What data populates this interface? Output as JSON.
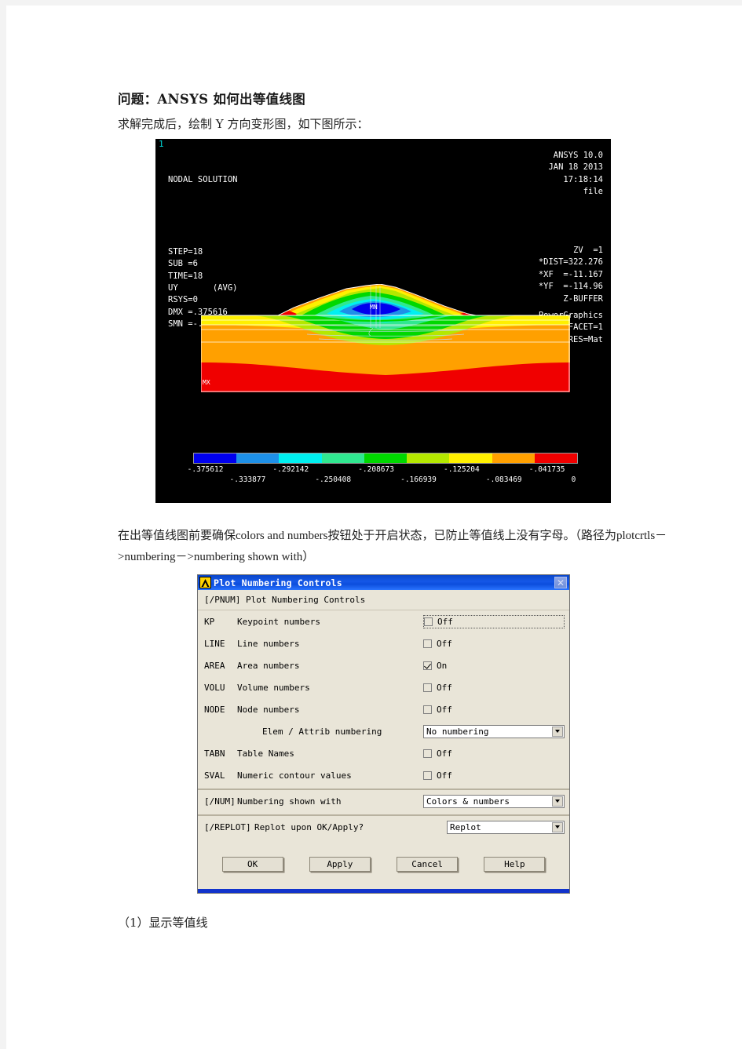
{
  "document": {
    "heading": "问题：ANSYS 如何出等值线图",
    "line_after_heading": "求解完成后，绘制 Y 方向变形图，如下图所示：",
    "paragraph_cn_1": "在出等值线图前要确保",
    "paragraph_en_1": "colors  and  numbers",
    "paragraph_cn_2": "按钮处于开启状态，已防止等值线上没有字母。（路径为",
    "paragraph_en_2": "plotcrtls－>numbering－>numbering  shown  with",
    "paragraph_cn_3": "）",
    "footer_line": "（1）显示等值线"
  },
  "ansys_plot": {
    "window_number": "1",
    "header_left": "NODAL SOLUTION",
    "left_block": "STEP=18\nSUB =6\nTIME=18\nUY       (AVG)\nRSYS=0\nDMX =.375616\nSMN =-.375612",
    "right_block": "ANSYS 10.0\nJAN 18 2013\n17:18:14\nfile",
    "right_block_2": "ZV  =1\n*DIST=322.276\n*XF  =-11.167\n*YF  =-114.96\nZ-BUFFER",
    "right_block_3": "PowerGraphics\nEFACET=1\nAVRES=Mat",
    "min_marker": "MN",
    "max_marker": "MX",
    "colorbar_colors": [
      "#0000ee",
      "#1e90e8",
      "#00f0f0",
      "#30e890",
      "#00d800",
      "#b4e800",
      "#fff000",
      "#ffa000",
      "#f00000"
    ],
    "legend_row1": [
      "-.375612",
      "-.292142",
      "-.208673",
      "-.125204",
      "-.041735"
    ],
    "legend_row2": [
      "-.333877",
      "-.250408",
      "-.166939",
      "-.083469",
      "0"
    ]
  },
  "chart_data": {
    "type": "heatmap",
    "title": "NODAL SOLUTION UY (AVG)",
    "xlabel": "",
    "ylabel": "",
    "colorbar_levels": [
      -0.375612,
      -0.333877,
      -0.292142,
      -0.250408,
      -0.208673,
      -0.166939,
      -0.125204,
      -0.083469,
      -0.041735,
      0
    ],
    "colorbar_colors": [
      "#0000ee",
      "#1e90e8",
      "#00f0f0",
      "#30e890",
      "#00d800",
      "#b4e800",
      "#fff000",
      "#ffa000",
      "#f00000"
    ],
    "legend_position": "bottom",
    "grid": false,
    "annotations": [
      "MN",
      "MX"
    ],
    "metadata_labels": {
      "STEP": "18",
      "SUB": "6",
      "TIME": "18",
      "RESULT": "UY (AVG)",
      "RSYS": "0",
      "DMX": ".375616",
      "SMN": "-.375612",
      "ZV": "1",
      "DIST": "322.276",
      "XF": "-11.167",
      "YF": "-114.96"
    }
  },
  "dialog": {
    "title": "Plot Numbering Controls",
    "close_glyph": "✕",
    "header": "[/PNUM]  Plot Numbering Controls",
    "rows": [
      {
        "code": "KP",
        "label": "Keypoint numbers",
        "control": "checkbox",
        "checked": false,
        "value": "Off",
        "focused": true
      },
      {
        "code": "LINE",
        "label": "Line numbers",
        "control": "checkbox",
        "checked": false,
        "value": "Off",
        "focused": false
      },
      {
        "code": "AREA",
        "label": "Area numbers",
        "control": "checkbox",
        "checked": true,
        "value": "On",
        "focused": false
      },
      {
        "code": "VOLU",
        "label": "Volume numbers",
        "control": "checkbox",
        "checked": false,
        "value": "Off",
        "focused": false
      },
      {
        "code": "NODE",
        "label": "Node numbers",
        "control": "checkbox",
        "checked": false,
        "value": "Off",
        "focused": false
      },
      {
        "code": "",
        "label": "Elem / Attrib numbering",
        "control": "combo",
        "value": "No numbering",
        "focused": false
      },
      {
        "code": "TABN",
        "label": "Table Names",
        "control": "checkbox",
        "checked": false,
        "value": "Off",
        "focused": false
      },
      {
        "code": "SVAL",
        "label": "Numeric contour values",
        "control": "checkbox",
        "checked": false,
        "value": "Off",
        "focused": false
      }
    ],
    "num_row": {
      "code": "[/NUM]",
      "label": "Numbering shown with",
      "value": "Colors & numbers"
    },
    "replot_row": {
      "code": "[/REPLOT]",
      "label": "Replot upon OK/Apply?",
      "value": "Replot"
    },
    "buttons": [
      "OK",
      "Apply",
      "Cancel",
      "Help"
    ]
  }
}
